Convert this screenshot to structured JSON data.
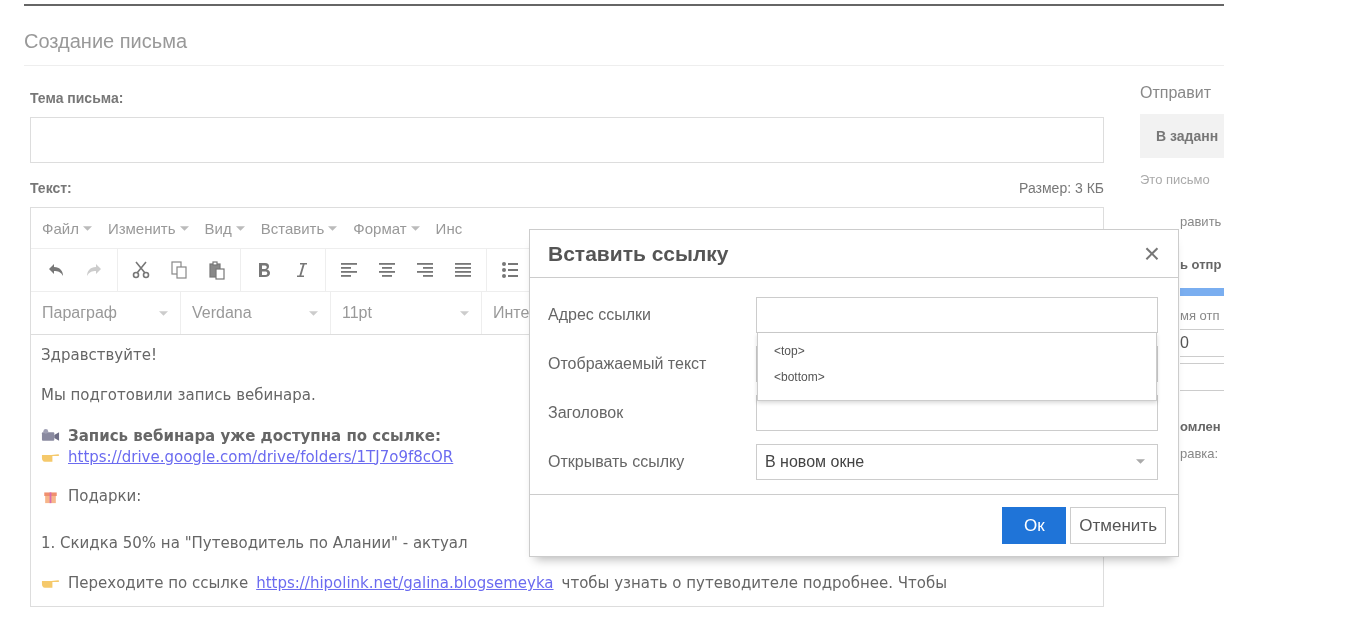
{
  "page": {
    "title": "Создание письма"
  },
  "subject": {
    "label": "Тема письма:"
  },
  "text": {
    "label": "Текст:",
    "size": "Размер: 3 КБ"
  },
  "editor": {
    "menu": [
      {
        "label": "Файл"
      },
      {
        "label": "Изменить"
      },
      {
        "label": "Вид"
      },
      {
        "label": "Вставить"
      },
      {
        "label": "Формат"
      },
      {
        "label": "Инс"
      }
    ],
    "selects": [
      {
        "value": "Параграф"
      },
      {
        "value": "Verdana"
      },
      {
        "value": "11pt"
      },
      {
        "value": "Инте"
      }
    ],
    "body": [
      {
        "kind": "plain",
        "text": "Здравствуйте!"
      },
      {
        "kind": "plain",
        "text": "Мы подготовили запись вебинара."
      },
      {
        "kind": "video",
        "text": "Запись вебинара уже доступна по ссылке:",
        "link": "https://drive.google.com/drive/folders/1TJ7o9f8cOR"
      },
      {
        "kind": "gift",
        "text": "Подарки:"
      },
      {
        "kind": "plain",
        "text": "1. Скидка 50% на \"Путеводитель по Алании\" - актуал"
      },
      {
        "kind": "pointer",
        "before": "Переходите по ссылке",
        "link": "https://hipolink.net/galina.blogsemeyka",
        "after": "чтобы узнать о путеводителе подробнее. Чтобы"
      }
    ]
  },
  "dialog": {
    "title": "Вставить ссылку",
    "close": "×",
    "fields": [
      {
        "label": "Адрес ссылки",
        "kind": "input"
      },
      {
        "label": "Отображаемый текст",
        "kind": "covered"
      },
      {
        "label": "Заголовок",
        "kind": "input"
      },
      {
        "label": "Открывать ссылку",
        "kind": "select",
        "value": "В новом окне"
      }
    ],
    "suggestions": [
      "<top>",
      "<bottom>"
    ],
    "buttons": [
      {
        "label": "Ок",
        "primary": true
      },
      {
        "label": "Отменить",
        "primary": false
      }
    ]
  },
  "sidebar": [
    {
      "kind": "heading",
      "text": "Отправит"
    },
    {
      "kind": "button",
      "text": "В заданн"
    },
    {
      "kind": "note",
      "text": "Это письмо"
    },
    {
      "kind": "label",
      "text": "равить"
    },
    {
      "kind": "bold",
      "text": "ь отпр"
    },
    {
      "kind": "bar",
      "level": 1
    },
    {
      "kind": "label",
      "text": "мя отп"
    },
    {
      "kind": "input",
      "text": "0"
    },
    {
      "kind": "input"
    },
    {
      "kind": "bold",
      "text": "омлен"
    },
    {
      "kind": "label",
      "text": "равка:"
    }
  ]
}
